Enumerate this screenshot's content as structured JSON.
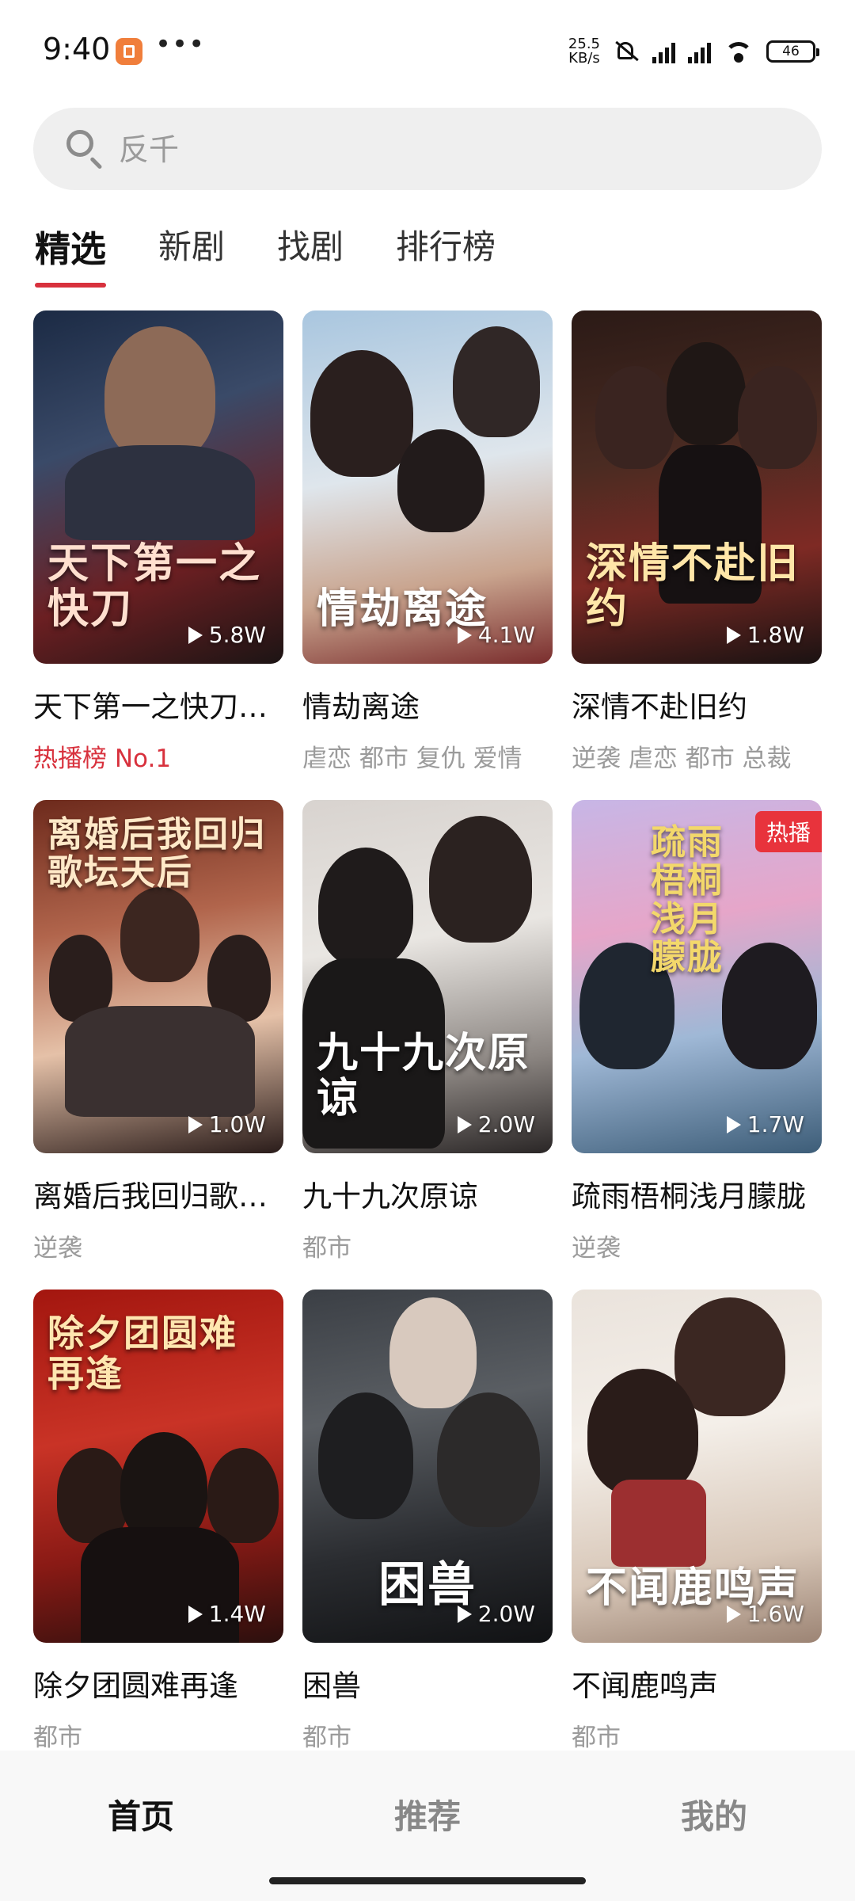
{
  "status_bar": {
    "time": "9:40",
    "dots": "•••",
    "net_speed_value": "25.5",
    "net_speed_unit": "KB/s",
    "battery": "46"
  },
  "search": {
    "placeholder": "反千"
  },
  "tabs": [
    {
      "label": "精选",
      "active": true
    },
    {
      "label": "新剧",
      "active": false
    },
    {
      "label": "找剧",
      "active": false
    },
    {
      "label": "排行榜",
      "active": false
    }
  ],
  "cards": [
    {
      "title": "天下第一之快刀…",
      "poster_text": "天下第一之快刀",
      "plays": "5.8W",
      "tags": "热播榜 No.1"
    },
    {
      "title": "情劫离途",
      "poster_text": "情劫离途",
      "plays": "4.1W",
      "tags": "虐恋 都市 复仇 爱情"
    },
    {
      "title": "深情不赴旧约",
      "poster_text": "深情不赴旧约",
      "plays": "1.8W",
      "tags": "逆袭 虐恋 都市 总裁"
    },
    {
      "title": "离婚后我回归歌…",
      "poster_text": "离婚后我回归歌坛天后",
      "plays": "1.0W",
      "tags": "逆袭"
    },
    {
      "title": "九十九次原谅",
      "poster_text": "九十九次原谅",
      "plays": "2.0W",
      "tags": "都市"
    },
    {
      "title": "疏雨梧桐浅月朦胧",
      "poster_text": "疏雨梧桐浅月朦胧",
      "plays": "1.7W",
      "tags": "逆袭",
      "badge": "热播"
    },
    {
      "title": "除夕团圆难再逢",
      "poster_text": "除夕团圆难再逢",
      "plays": "1.4W",
      "tags": "都市"
    },
    {
      "title": "困兽",
      "poster_text": "困兽",
      "plays": "2.0W",
      "tags": "都市"
    },
    {
      "title": "不闻鹿鸣声",
      "poster_text": "不闻鹿鸣声",
      "plays": "1.6W",
      "tags": "都市"
    }
  ],
  "bottom_nav": [
    {
      "label": "首页",
      "active": true
    },
    {
      "label": "推荐",
      "active": false
    },
    {
      "label": "我的",
      "active": false
    }
  ],
  "colors": {
    "accent": "#d8313d",
    "hot_badge": "#e8333c"
  }
}
